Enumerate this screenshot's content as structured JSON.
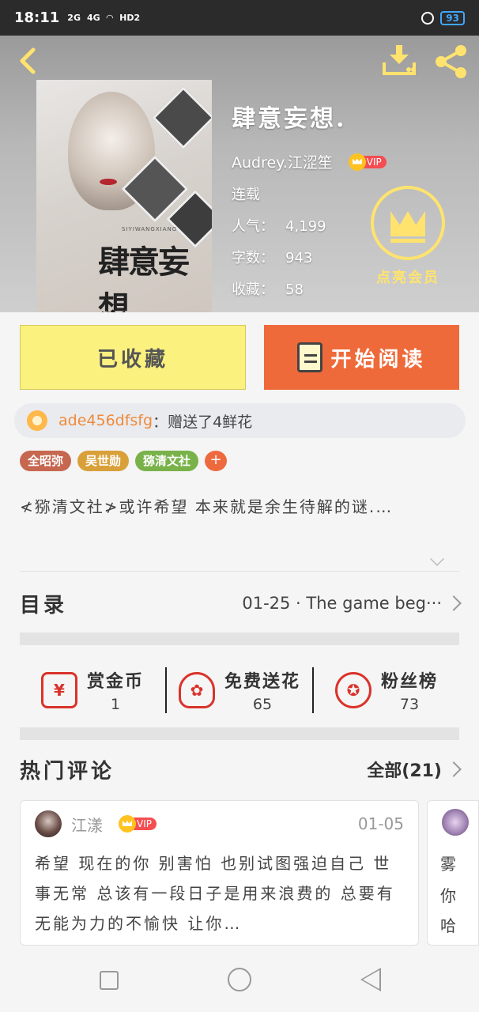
{
  "status_bar": {
    "time": "18:11",
    "signal1": "2G",
    "signal2": "4G",
    "hd": "HD2",
    "battery": "93"
  },
  "book": {
    "title": "肆意妄想.",
    "author": "Audrey.江涩笙",
    "vip_label": "VIP",
    "status": "连载",
    "stats": [
      {
        "key": "人气：",
        "value": "4,199"
      },
      {
        "key": "字数：",
        "value": "943"
      },
      {
        "key": "收藏：",
        "value": "58"
      }
    ],
    "cover_title": "肆意妄想",
    "cover_subtitle": "SIYIWANGXIANG"
  },
  "member": {
    "label": "点亮会员"
  },
  "actions": {
    "collected_label": "已收藏",
    "read_label": "开始阅读"
  },
  "gift": {
    "user": "ade456dfsfg",
    "message": "：赠送了4鲜花"
  },
  "tags": [
    {
      "label": "全昭弥",
      "color": "#c6674f"
    },
    {
      "label": "吴世勋",
      "color": "#d9a03a"
    },
    {
      "label": "猕清文社",
      "color": "#7ab24a"
    }
  ],
  "tag_add": "+",
  "description": "≮猕清文社≯或许希望 本来就是余生待解的谜.…",
  "toc": {
    "title": "目录",
    "latest": "01-25 · The game beg···"
  },
  "stat_items": [
    {
      "label": "赏金币",
      "value": "1",
      "icon": "red-envelope-icon",
      "glyph": "¥"
    },
    {
      "label": "免费送花",
      "value": "65",
      "icon": "flower-icon",
      "glyph": "✿"
    },
    {
      "label": "粉丝榜",
      "value": "73",
      "icon": "medal-icon",
      "glyph": "✪"
    }
  ],
  "comments": {
    "title": "热门评论",
    "all_label": "全部(21)",
    "items": [
      {
        "name": "江漾",
        "vip": "VIP",
        "date": "01-05",
        "text": "希望 现在的你 别害怕 也别试图强迫自己 世事无常 总该有一段日子是用来浪费的 总要有无能为力的不愉快 让你…"
      }
    ],
    "peek_snippets": [
      "雾",
      "你",
      "哈"
    ]
  },
  "colors": {
    "accent_orange": "#ef6a3a",
    "collect_yellow": "#fbf17f",
    "member_gold": "#ffe36e",
    "icon_red": "#d9332b"
  }
}
